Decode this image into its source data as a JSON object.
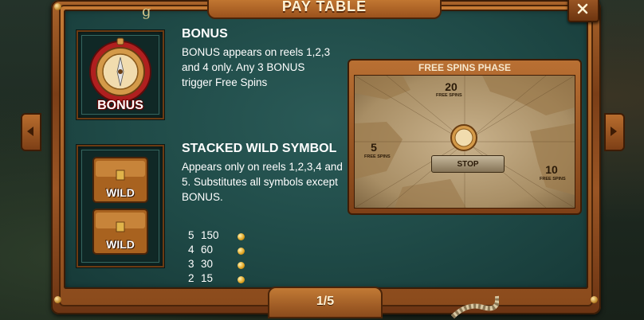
{
  "header": {
    "logo_text": "",
    "logo_suffix": "g",
    "title": "PAY TABLE"
  },
  "close_icon": "close-x",
  "bonus": {
    "heading": "BONUS",
    "lines": [
      "BONUS appears on reels 1,2,3",
      "and 4 only. Any 3 BONUS",
      "trigger Free Spins"
    ],
    "symbol_label": "BONUS"
  },
  "wild": {
    "heading": "STACKED WILD SYMBOL",
    "lines": [
      "Appears only on reels 1,2,3,4 and",
      "5. Substitutes all symbols except",
      "BONUS."
    ],
    "symbol_label": "WILD",
    "paytable": [
      {
        "count": "5",
        "payout": "150"
      },
      {
        "count": "4",
        "payout": "60"
      },
      {
        "count": "3",
        "payout": "30"
      },
      {
        "count": "2",
        "payout": "15"
      }
    ]
  },
  "free_spins": {
    "title": "FREE SPINS PHASE",
    "options": [
      {
        "number": "20",
        "label": "FREE SPINS"
      },
      {
        "number": "5",
        "label": "FREE SPINS"
      },
      {
        "number": "10",
        "label": "FREE SPINS"
      }
    ],
    "stop_label": "STOP"
  },
  "pagination": {
    "current": "1/5"
  },
  "colors": {
    "panel": "#1f4a47",
    "wood": "#9a5524",
    "text": "#ffffff",
    "coin": "#e0a21f"
  }
}
